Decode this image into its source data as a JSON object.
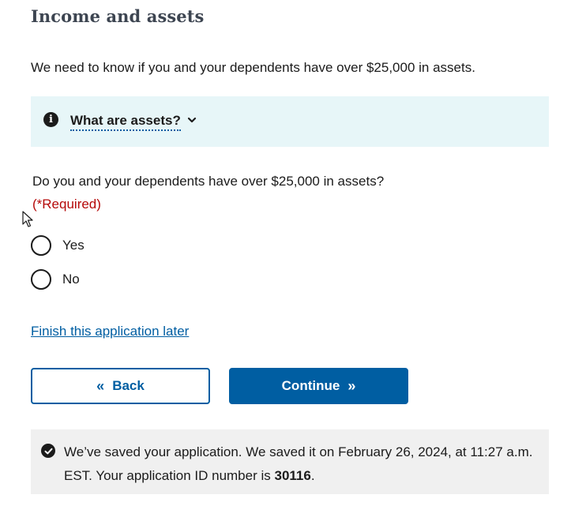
{
  "section": {
    "title": "Income and assets",
    "intro": "We need to know if you and your dependents have over $25,000 in assets."
  },
  "info_box": {
    "icon": "info-icon",
    "label": "What are assets?",
    "expanded": false
  },
  "question": {
    "text": "Do you and your dependents have over $25,000 in assets?",
    "required": "(*Required)",
    "options": [
      {
        "label": "Yes",
        "selected": false
      },
      {
        "label": "No",
        "selected": false
      }
    ]
  },
  "finish_later_link": "Finish this application later",
  "buttons": {
    "back": {
      "arrows": "«",
      "label": "Back"
    },
    "continue": {
      "label": "Continue",
      "arrows": "»"
    }
  },
  "saved_notice": {
    "icon": "check-circle-icon",
    "text_before": "We’ve saved your application. We saved it on February 26, 2024, at 11:27 a.m. EST. Your application ID number is ",
    "application_id": "30116",
    "text_after": "."
  },
  "colors": {
    "link_blue": "#005ea2",
    "required_red": "#b50909",
    "info_bg": "#e7f6f8",
    "notice_bg": "#f0f0f0"
  }
}
